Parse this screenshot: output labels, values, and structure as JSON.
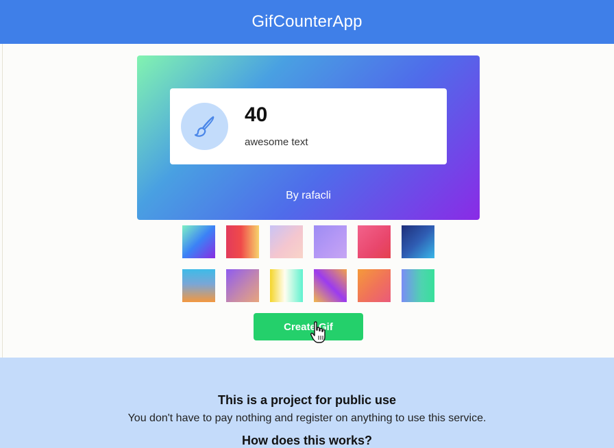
{
  "header": {
    "title": "GifCounterApp"
  },
  "preview": {
    "counter": "40",
    "label": "awesome text",
    "author": "By rafacli",
    "icon": "paintbrush-icon",
    "accent_color": "#3f7fe8"
  },
  "swatches": [
    {
      "name": "swatch-1",
      "gradient": "linear-gradient(135deg,#7ef0c4 0%,#3b82f6 50%,#8a2be2 100%)"
    },
    {
      "name": "swatch-2",
      "gradient": "linear-gradient(90deg,#e23b5b 0%,#f04a4a 45%,#f6d36c 100%)"
    },
    {
      "name": "swatch-3",
      "gradient": "linear-gradient(135deg,#c9c3f5 0%,#f4c6cf 55%,#f9d4c8 100%)"
    },
    {
      "name": "swatch-4",
      "gradient": "linear-gradient(135deg,#9d8cf4 0%,#b89af5 60%,#c6a6f3 100%)"
    },
    {
      "name": "swatch-5",
      "gradient": "linear-gradient(135deg,#f2628b 0%,#e9476d 60%,#e4414f 100%)"
    },
    {
      "name": "swatch-6",
      "gradient": "linear-gradient(135deg,#1e2e7a 0%,#2f5db3 50%,#39b7e8 100%)"
    },
    {
      "name": "swatch-7",
      "gradient": "linear-gradient(180deg,#3ebbe8 0%,#7aa6d6 45%,#f3983f 100%)"
    },
    {
      "name": "swatch-8",
      "gradient": "linear-gradient(135deg,#8e5cf0 0%,#c78aa8 60%,#e7a57c 100%)"
    },
    {
      "name": "swatch-9",
      "gradient": "linear-gradient(90deg,#f4d52a 0%,#fffdf0 45%,#5ff2cf 100%)"
    },
    {
      "name": "swatch-10",
      "gradient": "linear-gradient(45deg,#f2b84a 0%,#9b3bef 50%,#f1a24a 100%)"
    },
    {
      "name": "swatch-11",
      "gradient": "linear-gradient(135deg,#f59a3a 0%,#f0725a 55%,#ea5a7a 100%)"
    },
    {
      "name": "swatch-12",
      "gradient": "linear-gradient(90deg,#7a8cf5 0%,#4fd3b0 60%,#38e09a 100%)"
    }
  ],
  "actions": {
    "create_label": "Create Gif",
    "create_color": "#24d06b"
  },
  "info": {
    "title": "This is a project for public use",
    "text": "You don't have to pay nothing and register on anything to use this service.",
    "subtitle": "How does this works?"
  }
}
